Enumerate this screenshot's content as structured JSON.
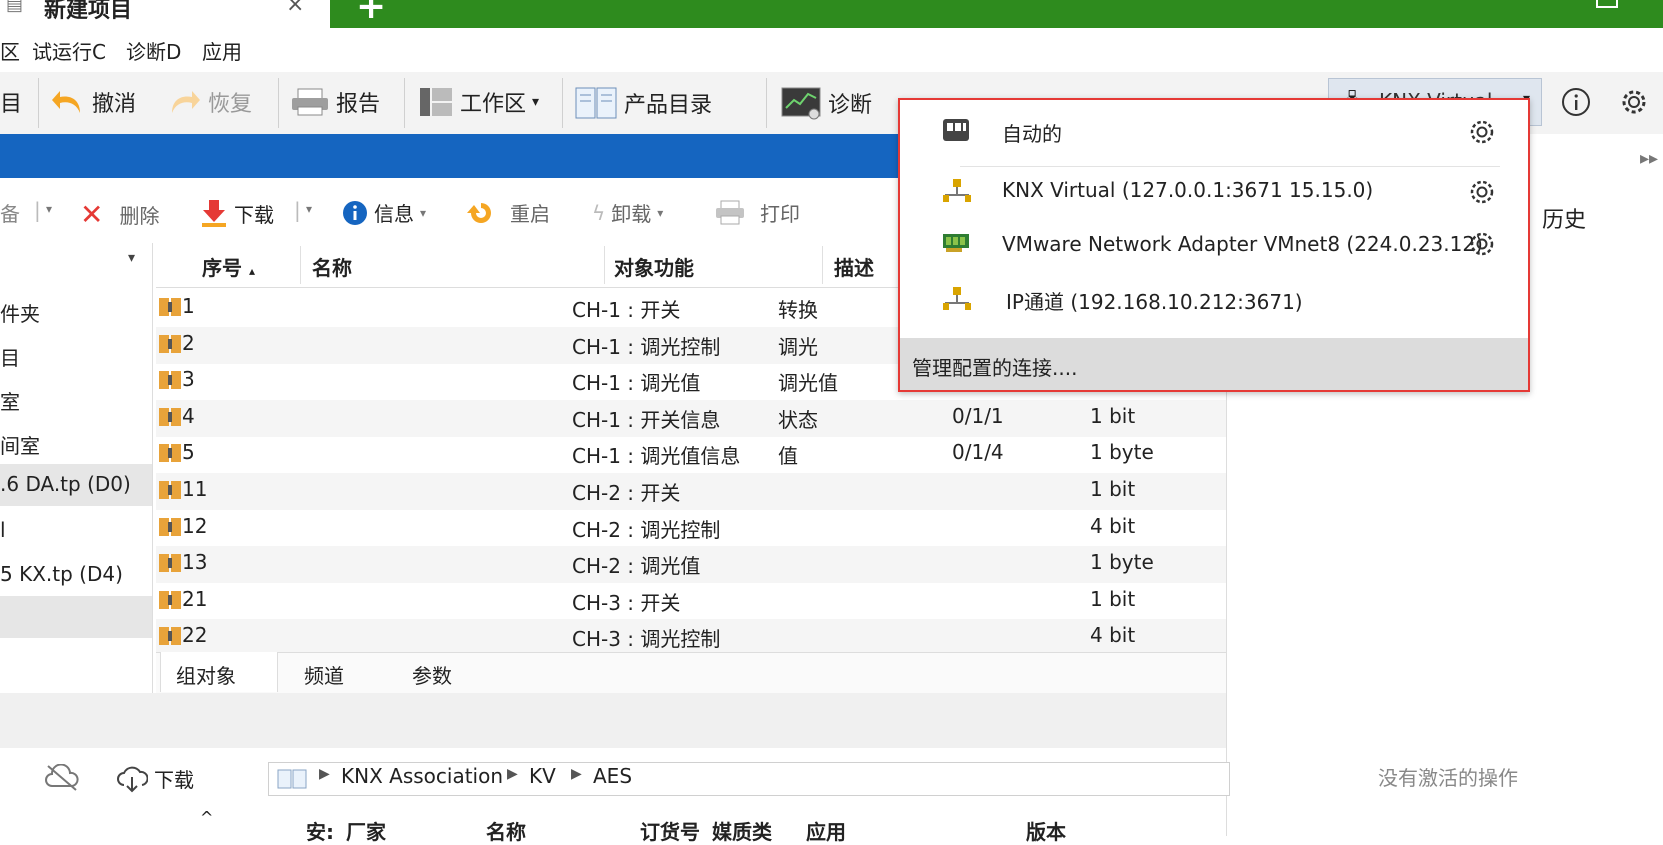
{
  "titlebar": {
    "tab_title": "新建项目",
    "close_glyph": "×",
    "add_glyph": "+"
  },
  "menu": {
    "items": [
      "区",
      "试运行C",
      "诊断D",
      "应用"
    ]
  },
  "toolbar": {
    "first_label": "目",
    "undo": "撤消",
    "redo": "恢复",
    "report": "报告",
    "workspace": "工作区",
    "catalog": "产品目录",
    "diagnostics": "诊断",
    "dropdown_arrow": "▾",
    "connection_value": "KNX Virtual"
  },
  "panel_toolbar": {
    "first": "备",
    "delete": "删除",
    "download": "下载",
    "info": "信息",
    "restart": "重启",
    "unload": "卸载",
    "print": "打印"
  },
  "tree": {
    "items": [
      "件夹",
      "目",
      "室",
      "间室",
      ".6 DA.tp (D0)",
      "l",
      "5 KX.tp (D4)"
    ]
  },
  "table": {
    "headers": [
      "序号",
      "名称",
      "对象功能",
      "描述"
    ],
    "sort_glyph": "▴",
    "rows": [
      {
        "no": "1",
        "func": "CH-1 : 开关",
        "desc": "转换",
        "addr": "",
        "size": ""
      },
      {
        "no": "2",
        "func": "CH-1 : 调光控制",
        "desc": "调光",
        "addr": "",
        "size": ""
      },
      {
        "no": "3",
        "func": "CH-1 : 调光值",
        "desc": "调光值",
        "addr": "",
        "size": ""
      },
      {
        "no": "4",
        "func": "CH-1 : 开关信息",
        "desc": "状态",
        "addr": "0/1/1",
        "size": "1 bit"
      },
      {
        "no": "5",
        "func": "CH-1 : 调光值信息",
        "desc": "值",
        "addr": "0/1/4",
        "size": "1 byte"
      },
      {
        "no": "11",
        "func": "CH-2 : 开关",
        "desc": "",
        "addr": "",
        "size": "1 bit"
      },
      {
        "no": "12",
        "func": "CH-2 : 调光控制",
        "desc": "",
        "addr": "",
        "size": "4 bit"
      },
      {
        "no": "13",
        "func": "CH-2 : 调光值",
        "desc": "",
        "addr": "",
        "size": "1 byte"
      },
      {
        "no": "21",
        "func": "CH-3 : 开关",
        "desc": "",
        "addr": "",
        "size": "1 bit"
      },
      {
        "no": "22",
        "func": "CH-3 : 调光控制",
        "desc": "",
        "addr": "",
        "size": "4 bit"
      }
    ]
  },
  "bottom_tabs": [
    "组对象",
    "频道",
    "参数"
  ],
  "catalog": {
    "download": "下载",
    "path": [
      "KNX Association",
      "KV",
      "AES"
    ],
    "headers": [
      "安:",
      "厂家",
      "名称",
      "订货号",
      "媒质类",
      "应用",
      "版本"
    ],
    "sort_glyph": "^"
  },
  "right_panel": {
    "history": "历史",
    "no_active": "没有激活的操作",
    "collapse_glyph": "▸▸"
  },
  "dropdown": {
    "items": [
      {
        "label": "自动的",
        "icon": "auto-icon"
      },
      {
        "label": "KNX Virtual  (127.0.0.1:3671 15.15.0)",
        "icon": "network-icon"
      },
      {
        "label": "VMware Network Adapter VMnet8 (224.0.23.12)",
        "icon": "network-card-icon"
      },
      {
        "label": "IP通道 (192.168.10.212:3671)",
        "icon": "network-icon"
      }
    ],
    "footer": "管理配置的连接...."
  },
  "colors": {
    "titlebar": "#2e8b1e",
    "bluebar": "#1565c0",
    "highlight_border": "#e53935",
    "delete_red": "#e53935",
    "info_blue": "#1565c0",
    "orange": "#f5a623"
  }
}
